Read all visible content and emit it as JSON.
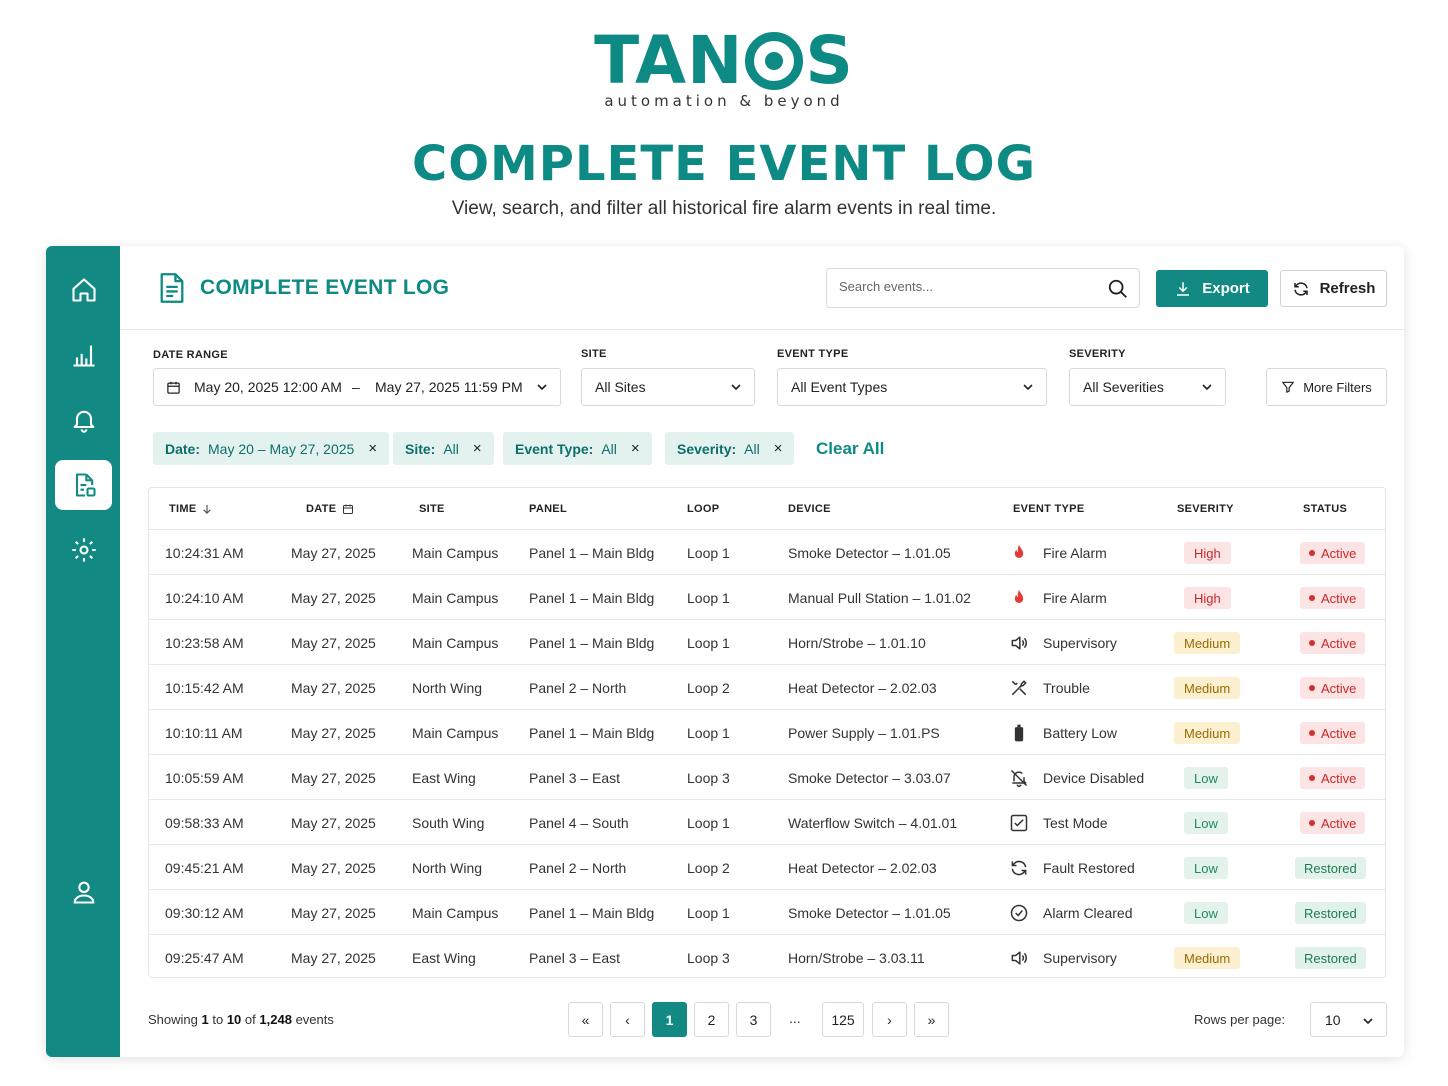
{
  "brand": {
    "logo_left": "TAN",
    "logo_right": "S",
    "tagline": "automation & beyond"
  },
  "hero": {
    "title": "COMPLETE EVENT LOG",
    "subtitle": "View, search, and filter all historical fire alarm events in real time."
  },
  "sidebar": {
    "items": [
      "home-icon",
      "chart-icon",
      "bell-icon",
      "report-icon",
      "gear-icon",
      "user-icon"
    ],
    "active": "report-icon"
  },
  "topbar": {
    "title": "COMPLETE EVENT LOG",
    "search_placeholder": "Search events...",
    "export_label": "Export",
    "refresh_label": "Refresh"
  },
  "filters": {
    "date_range": {
      "label": "DATE RANGE",
      "start": "May 20, 2025 12:00 AM",
      "separator": "–",
      "end": "May 27, 2025 11:59 PM"
    },
    "site": {
      "label": "SITE",
      "value": "All Sites"
    },
    "event_type": {
      "label": "EVENT TYPE",
      "value": "All Event Types"
    },
    "severity": {
      "label": "SEVERITY",
      "value": "All Severities"
    },
    "more_label": "More Filters"
  },
  "chips": [
    {
      "key": "Date:",
      "value": "May 20 – May 27, 2025"
    },
    {
      "key": "Site:",
      "value": "All"
    },
    {
      "key": "Event Type:",
      "value": "All"
    },
    {
      "key": "Severity:",
      "value": "All"
    }
  ],
  "chip_close": "×",
  "clear_all": "Clear All",
  "table": {
    "headers": [
      "TIME",
      "DATE",
      "SITE",
      "PANEL",
      "LOOP",
      "DEVICE",
      "EVENT TYPE",
      "SEVERITY",
      "STATUS"
    ],
    "rows": [
      {
        "time": "10:24:31 AM",
        "date": "May 27, 2025",
        "site": "Main Campus",
        "panel": "Panel 1 – Main Bldg",
        "loop": "Loop 1",
        "device": "Smoke Detector – 1.01.05",
        "event": "Fire Alarm",
        "icon": "flame-icon",
        "severity": "High",
        "sev_class": "high",
        "status": "Active",
        "stat_class": "active"
      },
      {
        "time": "10:24:10 AM",
        "date": "May 27, 2025",
        "site": "Main Campus",
        "panel": "Panel 1 – Main Bldg",
        "loop": "Loop 1",
        "device": "Manual Pull Station – 1.01.02",
        "event": "Fire Alarm",
        "icon": "flame-icon",
        "severity": "High",
        "sev_class": "high",
        "status": "Active",
        "stat_class": "active"
      },
      {
        "time": "10:23:58 AM",
        "date": "May 27, 2025",
        "site": "Main Campus",
        "panel": "Panel 1 – Main Bldg",
        "loop": "Loop 1",
        "device": "Horn/Strobe – 1.01.10",
        "event": "Supervisory",
        "icon": "speaker-icon",
        "severity": "Medium",
        "sev_class": "medium",
        "status": "Active",
        "stat_class": "active"
      },
      {
        "time": "10:15:42 AM",
        "date": "May 27, 2025",
        "site": "North Wing",
        "panel": "Panel 2 – North",
        "loop": "Loop 2",
        "device": "Heat Detector – 2.02.03",
        "event": "Trouble",
        "icon": "tools-icon",
        "severity": "Medium",
        "sev_class": "medium",
        "status": "Active",
        "stat_class": "active"
      },
      {
        "time": "10:10:11 AM",
        "date": "May 27, 2025",
        "site": "Main Campus",
        "panel": "Panel 1 – Main Bldg",
        "loop": "Loop 1",
        "device": "Power Supply – 1.01.PS",
        "event": "Battery Low",
        "icon": "battery-icon",
        "severity": "Medium",
        "sev_class": "medium",
        "status": "Active",
        "stat_class": "active"
      },
      {
        "time": "10:05:59 AM",
        "date": "May 27, 2025",
        "site": "East Wing",
        "panel": "Panel 3 – East",
        "loop": "Loop 3",
        "device": "Smoke Detector – 3.03.07",
        "event": "Device Disabled",
        "icon": "bell-off-icon",
        "severity": "Low",
        "sev_class": "low",
        "status": "Active",
        "stat_class": "active"
      },
      {
        "time": "09:58:33 AM",
        "date": "May 27, 2025",
        "site": "South Wing",
        "panel": "Panel 4 – South",
        "loop": "Loop 1",
        "device": "Waterflow Switch – 4.01.01",
        "event": "Test Mode",
        "icon": "checkbox-icon",
        "severity": "Low",
        "sev_class": "low",
        "status": "Active",
        "stat_class": "active"
      },
      {
        "time": "09:45:21 AM",
        "date": "May 27, 2025",
        "site": "North Wing",
        "panel": "Panel 2 – North",
        "loop": "Loop 2",
        "device": "Heat Detector – 2.02.03",
        "event": "Fault Restored",
        "icon": "refresh-icon",
        "severity": "Low",
        "sev_class": "low",
        "status": "Restored",
        "stat_class": "restored"
      },
      {
        "time": "09:30:12 AM",
        "date": "May 27, 2025",
        "site": "Main Campus",
        "panel": "Panel 1 – Main Bldg",
        "loop": "Loop 1",
        "device": "Smoke Detector – 1.01.05",
        "event": "Alarm Cleared",
        "icon": "check-circle-icon",
        "severity": "Low",
        "sev_class": "low",
        "status": "Restored",
        "stat_class": "restored"
      },
      {
        "time": "09:25:47 AM",
        "date": "May 27, 2025",
        "site": "East Wing",
        "panel": "Panel 3 – East",
        "loop": "Loop 3",
        "device": "Horn/Strobe – 3.03.11",
        "event": "Supervisory",
        "icon": "speaker-icon",
        "severity": "Medium",
        "sev_class": "medium",
        "status": "Restored",
        "stat_class": "restored"
      }
    ]
  },
  "footer": {
    "showing_prefix": "Showing",
    "range_start": "1",
    "to": "to",
    "range_end": "10",
    "of": "of",
    "total": "1,248",
    "suffix": "events",
    "pages": [
      "1",
      "2",
      "3"
    ],
    "ellipsis": "...",
    "last_page": "125",
    "current_page": "1",
    "first_glyph": "«",
    "prev_glyph": "‹",
    "next_glyph": "›",
    "last_glyph": "»",
    "rows_per_page_label": "Rows per page:",
    "rows_per_page": "10"
  },
  "colors": {
    "primary": "#128a83",
    "high": "#c62828",
    "medium": "#9a6a00",
    "low": "#1f8a5b"
  }
}
